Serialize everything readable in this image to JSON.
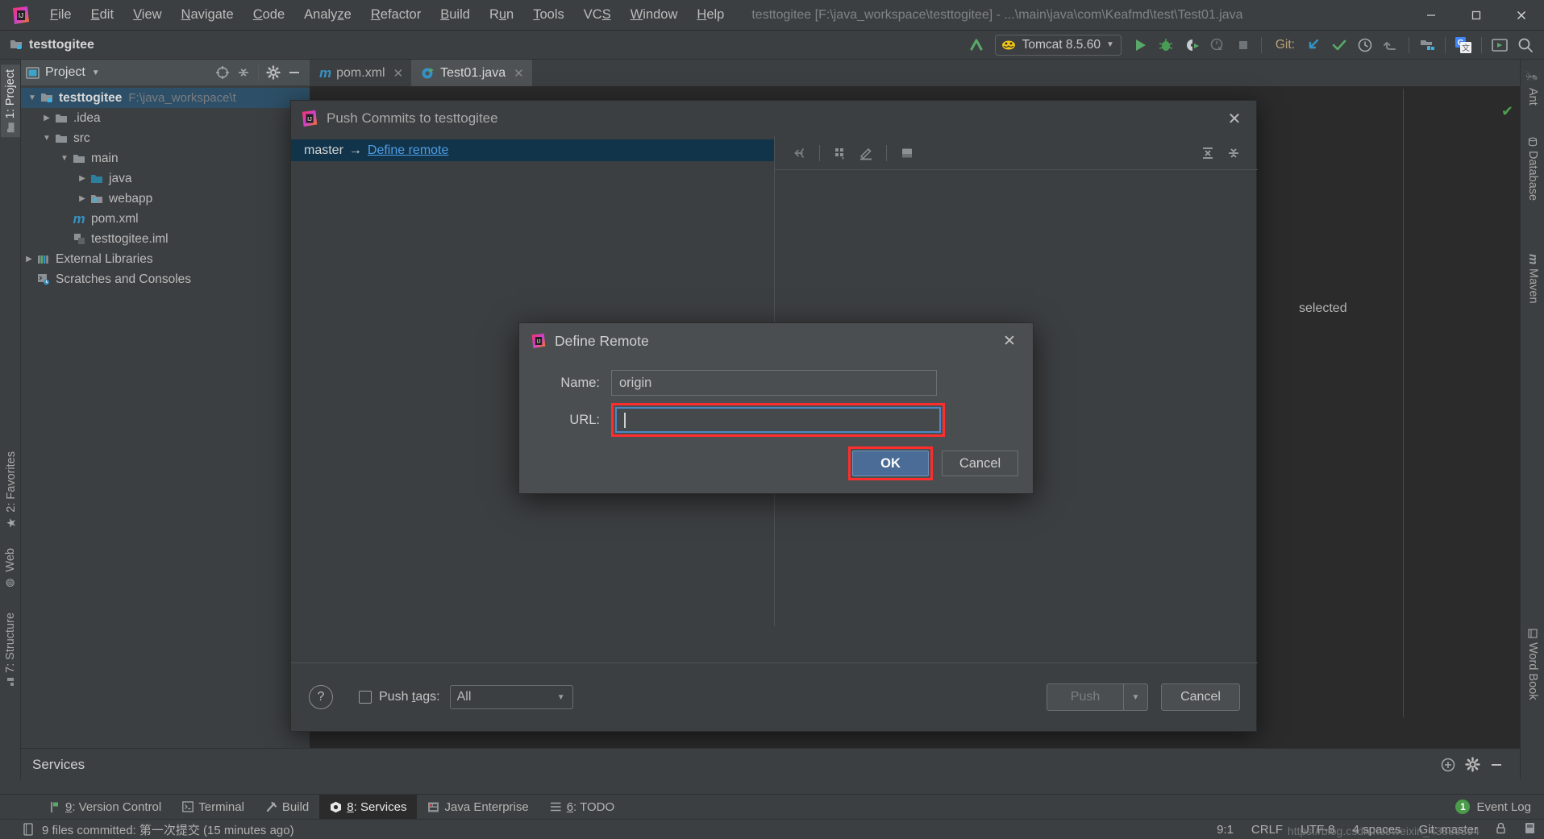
{
  "titlebar": {
    "menu": [
      "File",
      "Edit",
      "View",
      "Navigate",
      "Code",
      "Analyze",
      "Refactor",
      "Build",
      "Run",
      "Tools",
      "VCS",
      "Window",
      "Help"
    ],
    "window_title": "testtogitee [F:\\java_workspace\\testtogitee] - ...\\main\\java\\com\\Keafmd\\test\\Test01.java",
    "minimize": "─",
    "maximize": "☐",
    "close": "✕"
  },
  "toolbar": {
    "project_name": "testtogitee",
    "run_config": "Tomcat 8.5.60",
    "git_label": "Git:"
  },
  "left_stripe": [
    {
      "label": "1: Project",
      "accel": "1",
      "selected": true
    },
    {
      "label": "2: Favorites",
      "accel": "2",
      "selected": false
    },
    {
      "label": "Web",
      "accel": "",
      "selected": false
    },
    {
      "label": "7: Structure",
      "accel": "7",
      "selected": false
    }
  ],
  "right_stripe": [
    {
      "label": "Ant"
    },
    {
      "label": "Database"
    },
    {
      "label": "Maven"
    },
    {
      "label": "Word Book"
    }
  ],
  "project_panel": {
    "header_title": "Project",
    "tree": [
      {
        "level": 0,
        "arrow": "down",
        "icon": "module-icon",
        "label": "testtogitee",
        "bold": true,
        "path": "F:\\java_workspace\\t",
        "selected": true
      },
      {
        "level": 1,
        "arrow": "right",
        "icon": "folder-icon",
        "label": ".idea",
        "bold": false,
        "path": "",
        "selected": false
      },
      {
        "level": 1,
        "arrow": "down",
        "icon": "folder-icon",
        "label": "src",
        "bold": false,
        "path": "",
        "selected": false
      },
      {
        "level": 2,
        "arrow": "down",
        "icon": "folder-icon",
        "label": "main",
        "bold": false,
        "path": "",
        "selected": false
      },
      {
        "level": 3,
        "arrow": "right",
        "icon": "source-folder-icon",
        "label": "java",
        "bold": false,
        "path": "",
        "selected": false
      },
      {
        "level": 3,
        "arrow": "right",
        "icon": "webapp-folder-icon",
        "label": "webapp",
        "bold": false,
        "path": "",
        "selected": false
      },
      {
        "level": 2,
        "arrow": "none",
        "icon": "maven-icon",
        "label": "pom.xml",
        "bold": false,
        "path": "",
        "selected": false
      },
      {
        "level": 2,
        "arrow": "none",
        "icon": "iml-icon",
        "label": "testtogitee.iml",
        "bold": false,
        "path": "",
        "selected": false
      },
      {
        "level": 0,
        "arrow": "right",
        "icon": "library-icon",
        "label": "External Libraries",
        "bold": false,
        "path": "",
        "selected": false
      },
      {
        "level": 0,
        "arrow": "none",
        "icon": "scratch-icon",
        "label": "Scratches and Consoles",
        "bold": false,
        "path": "",
        "selected": false
      }
    ]
  },
  "editor_tabs": [
    {
      "label": "pom.xml",
      "icon": "maven-icon",
      "active": false
    },
    {
      "label": "Test01.java",
      "icon": "class-run-icon",
      "active": true
    }
  ],
  "push_dialog": {
    "title": "Push Commits to testtogitee",
    "branch_source": "master",
    "branch_arrow": "→",
    "define_remote_link": "Define remote",
    "selected_text": "selected",
    "help_label": "?",
    "push_tags_label_pre": "Push ",
    "push_tags_label_accel": "t",
    "push_tags_label_post": "ags:",
    "push_tags_value": "All",
    "push_button": "Push",
    "cancel_button": "Cancel"
  },
  "define_remote": {
    "title": "Define Remote",
    "name_label": "Name:",
    "name_value": "origin",
    "url_label": "URL:",
    "url_value": "",
    "url_placeholder": "",
    "ok_button": "OK",
    "cancel_button": "Cancel",
    "close_icon": "✕",
    "highlight_color": "#ff2d2d",
    "focus_color": "#4a88c7",
    "ok_color": "#4a6c96"
  },
  "services_panel": {
    "title": "Services"
  },
  "toolwindow_bar": [
    {
      "label": "9: Version Control",
      "accel": "9",
      "icon": "branch-icon",
      "selected": false
    },
    {
      "label": "Terminal",
      "accel": "",
      "icon": "terminal-icon",
      "selected": false
    },
    {
      "label": "Build",
      "accel": "",
      "icon": "hammer-icon",
      "selected": false
    },
    {
      "label": "8: Services",
      "accel": "8",
      "icon": "services-icon",
      "selected": true
    },
    {
      "label": "Java Enterprise",
      "accel": "",
      "icon": "jee-icon",
      "selected": false
    },
    {
      "label": "6: TODO",
      "accel": "6",
      "icon": "todo-icon",
      "selected": false
    }
  ],
  "event_log": {
    "label": "Event Log",
    "badge": "1"
  },
  "statusbar": {
    "message": "9 files committed: 第一次提交 (15 minutes ago)",
    "caret": "9:1",
    "line_sep": "CRLF",
    "encoding": "UTF-8",
    "indent": "4 spaces",
    "git_branch": "Git: master",
    "watermark": "https://blog.csdn.net/weixin_43888394"
  }
}
